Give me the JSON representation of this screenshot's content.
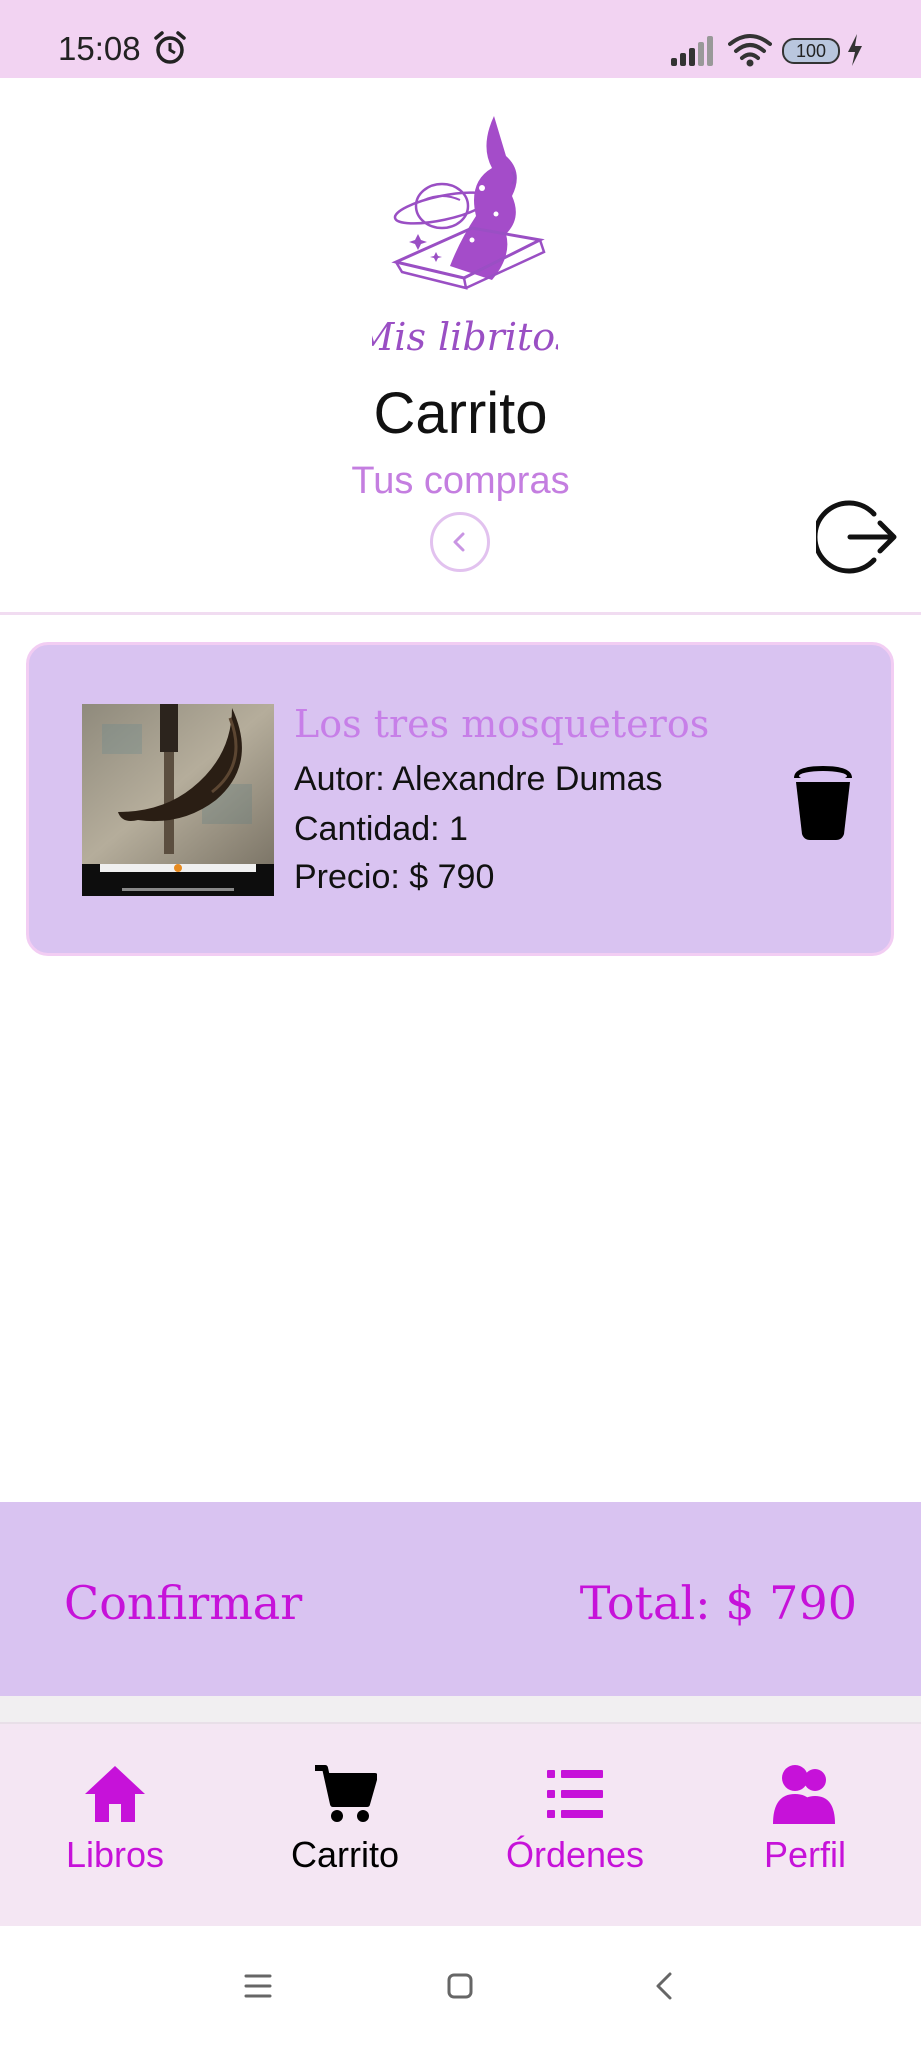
{
  "status_bar": {
    "time": "15:08",
    "battery": "100"
  },
  "header": {
    "logo_text": "Mis libritos",
    "title": "Carrito",
    "subtitle": "Tus compras"
  },
  "cart": {
    "items": [
      {
        "title": "Los tres mosqueteros",
        "author": "Autor: Alexandre Dumas",
        "quantity": "Cantidad: 1",
        "price": "Precio: $ 790"
      }
    ]
  },
  "footer": {
    "confirm_label": "Confirmar",
    "total_label": "Total: $ 790"
  },
  "nav": {
    "items": [
      {
        "label": "Libros"
      },
      {
        "label": "Carrito"
      },
      {
        "label": "Órdenes"
      },
      {
        "label": "Perfil"
      }
    ],
    "active_color": "#000000",
    "inactive_color": "#c612d9"
  },
  "colors": {
    "status_bar": "#f2d3f2",
    "card": "#d9c3f1",
    "accent": "#c612d9",
    "subtitle": "#c47ee0"
  }
}
